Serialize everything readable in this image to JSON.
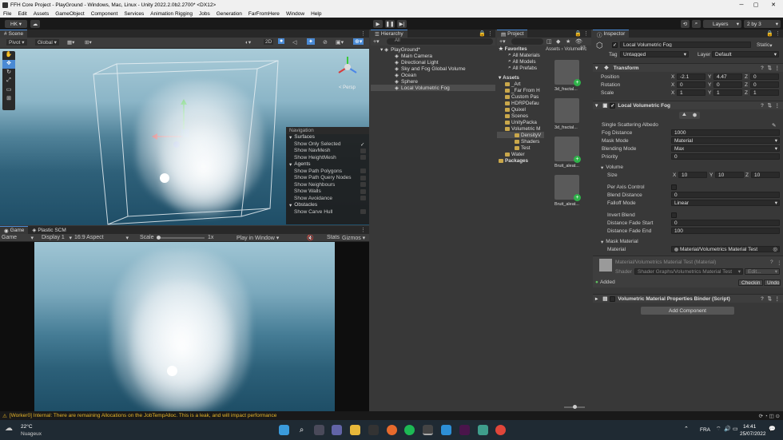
{
  "window": {
    "title": "FFH Core Project - PlayGround - Windows, Mac, Linux - Unity 2022.2.0b2.2700* <DX12>",
    "min": "─",
    "max": "▢",
    "close": "✕"
  },
  "menu": [
    "File",
    "Edit",
    "Assets",
    "GameObject",
    "Component",
    "Services",
    "Animation Rigging",
    "Jobs",
    "Generation",
    "FarFromHere",
    "Window",
    "Help"
  ],
  "toolbar": {
    "account": "HK ▾",
    "layers": "Layers",
    "layout": "2 by 3"
  },
  "scene": {
    "tab": "Scene",
    "pivot": "Pivot ▾",
    "global": "Global ▾",
    "mode2d": "2D",
    "persp": "< Persp"
  },
  "navigation": {
    "title": "Navigation",
    "sections": [
      {
        "header": "Surfaces",
        "items": [
          "Show Only Selected",
          "Show NavMesh",
          "Show HeightMesh"
        ]
      },
      {
        "header": "Agents",
        "items": [
          "Show Path Polygons",
          "Show Path Query Nodes",
          "Show Neighbours",
          "Show Walls",
          "Show Avoidance"
        ]
      },
      {
        "header": "Obstacles",
        "items": [
          "Show Carve Hull"
        ]
      }
    ]
  },
  "game": {
    "tab": "Game",
    "tab2": "Plastic SCM",
    "display_mode": "Game",
    "display": "Display 1",
    "aspect": "16:9 Aspect",
    "scale_label": "Scale",
    "scale_value": "1x",
    "play_mode": "Play in Window",
    "stats": "Stats",
    "gizmos": "Gizmos"
  },
  "hierarchy": {
    "tab": "Hierarchy",
    "search": "All",
    "root": "PlayGround*",
    "items": [
      "Main Camera",
      "Directional Light",
      "Sky and Fog Global Volume",
      "Ocean",
      "Sphere",
      "Local Volumetric Fog"
    ]
  },
  "project": {
    "tab": "Project",
    "breadcrumb": "Assets › Volumetric",
    "favorites": {
      "label": "Favorites",
      "items": [
        "All Materials",
        "All Models",
        "All Prefabs"
      ]
    },
    "assets": {
      "label": "Assets",
      "items": [
        "_Art",
        "_Far From H",
        "Custom Pas",
        "HDRPDefau",
        "Quixel",
        "Scenes",
        "UnityPacka",
        "Volumetric M"
      ]
    },
    "volumetric_children": [
      "DensityV",
      "Shaders",
      "Test"
    ],
    "after": [
      "Water"
    ],
    "packages": "Packages",
    "grid": [
      "3d_fractal...",
      "3d_fractal...",
      "Bruit_aleat...",
      "Bruit_aleat..."
    ],
    "count_badge": "27"
  },
  "inspector": {
    "tab": "Inspector",
    "object_name": "Local Volumetric Fog",
    "static": "Static",
    "tag_label": "Tag",
    "tag": "Untagged",
    "layer_label": "Layer",
    "layer": "Default",
    "transform": {
      "title": "Transform",
      "rows": [
        {
          "label": "Position",
          "x": "-2.1",
          "y": "4.47",
          "z": "0"
        },
        {
          "label": "Rotation",
          "x": "0",
          "y": "0",
          "z": "0"
        },
        {
          "label": "Scale",
          "x": "1",
          "y": "1",
          "z": "1"
        }
      ]
    },
    "fog": {
      "title": "Local Volumetric Fog",
      "albedo_label": "Single Scattering Albedo",
      "fog_distance_label": "Fog Distance",
      "fog_distance": "1000",
      "mask_mode_label": "Mask Mode",
      "mask_mode": "Material",
      "blending_mode_label": "Blending Mode",
      "blending_mode": "Max",
      "priority_label": "Priority",
      "priority": "0",
      "volume_label": "Volume",
      "size_label": "Size",
      "size_x": "10",
      "size_y": "10",
      "size_z": "10",
      "per_axis_label": "Per Axis Control",
      "blend_distance_label": "Blend Distance",
      "blend_distance": "0",
      "falloff_label": "Falloff Mode",
      "falloff": "Linear",
      "invert_blend_label": "Invert Blend",
      "fade_start_label": "Distance Fade Start",
      "fade_start": "0",
      "fade_end_label": "Distance Fade End",
      "fade_end": "100",
      "mask_material_label": "Mask Material",
      "material_label": "Material",
      "material": "Material/Volumetrics Material Test"
    },
    "material_block": {
      "name": "Material/Volumetrics Material Test (Material)",
      "shader_label": "Shader",
      "shader": "Shader Graphs/Volumetrics Material Test",
      "edit": "Edit...",
      "added": "Added",
      "checkin": "Checkin",
      "undo": "Undo"
    },
    "binder": "Volumetric Material Properties Binder (Script)",
    "add_component": "Add Component"
  },
  "status": "[Worker0] Internal: There are remaining Allocations on the JobTempAlloc. This is a leak, and will impact performance",
  "taskbar": {
    "temp": "22°C",
    "weather": "Nuageux",
    "lang": "FRA",
    "time": "14:41",
    "date": "25/07/2022"
  },
  "colors": {
    "accent": "#4a8ad4",
    "warning": "#e7b528",
    "selected": "#2c5d87"
  }
}
